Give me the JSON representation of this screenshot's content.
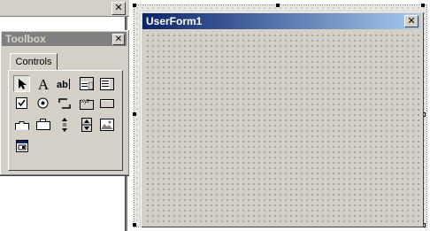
{
  "left_strip": {
    "close_glyph": "✕"
  },
  "toolbox": {
    "title": "Toolbox",
    "close_glyph": "✕",
    "tab_label": "Controls",
    "tools": [
      {
        "name": "select-objects",
        "glyph": "arrow-pointer"
      },
      {
        "name": "label",
        "glyph": "A"
      },
      {
        "name": "textbox",
        "glyph": "ab|"
      },
      {
        "name": "combobox",
        "glyph": "combobox"
      },
      {
        "name": "listbox",
        "glyph": "listbox"
      },
      {
        "name": "checkbox",
        "glyph": "checkbox"
      },
      {
        "name": "optionbutton",
        "glyph": "optionbutton"
      },
      {
        "name": "togglebutton",
        "glyph": "togglebutton"
      },
      {
        "name": "frame",
        "glyph": "frame"
      },
      {
        "name": "commandbutton",
        "glyph": "commandbutton"
      },
      {
        "name": "tabstrip",
        "glyph": "tabstrip"
      },
      {
        "name": "multipage",
        "glyph": "multipage"
      },
      {
        "name": "scrollbar",
        "glyph": "scrollbar"
      },
      {
        "name": "spinbutton",
        "glyph": "spinbutton"
      },
      {
        "name": "image",
        "glyph": "image"
      },
      {
        "name": "refedit",
        "glyph": "refedit"
      }
    ]
  },
  "userform": {
    "title": "UserForm1",
    "close_glyph": "✕"
  },
  "colors": {
    "face": "#d4d0c8",
    "title_active_start": "#0a246a",
    "title_active_end": "#a6caf0",
    "title_inactive": "#808080"
  }
}
